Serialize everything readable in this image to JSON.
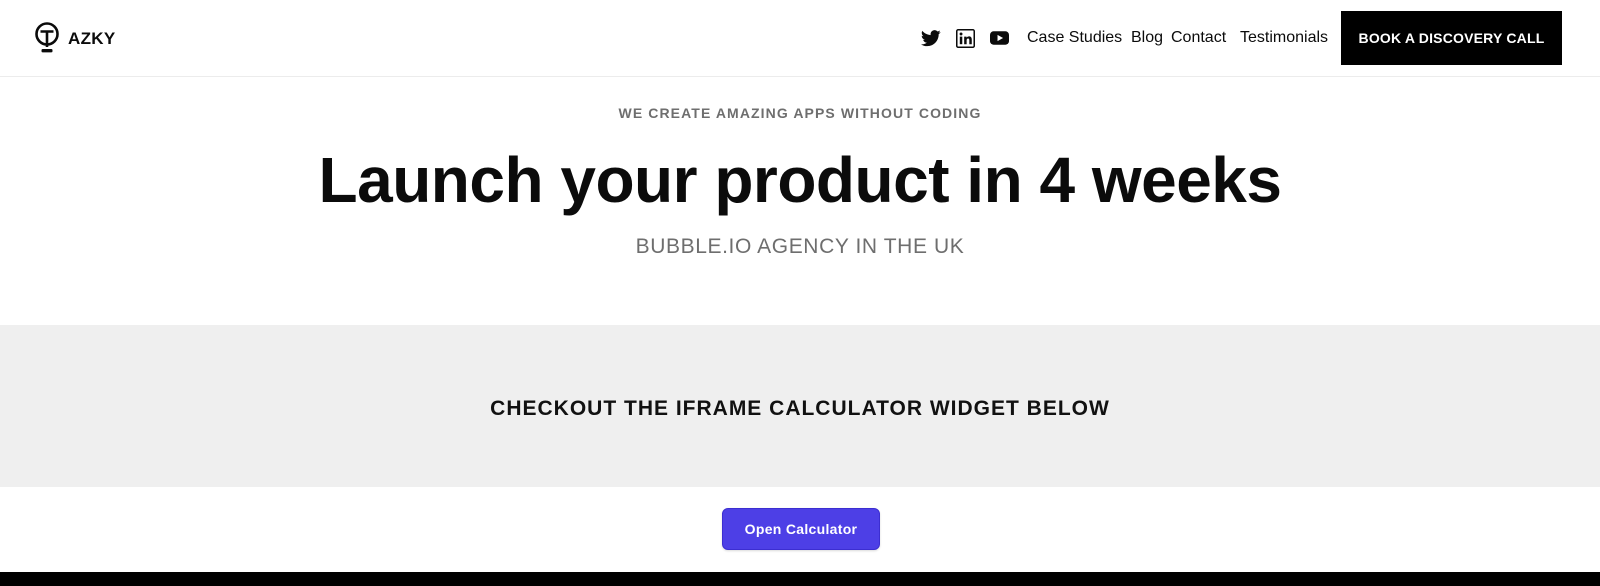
{
  "header": {
    "brand_name": "AZKY",
    "social": [
      "twitter-icon",
      "linkedin-icon",
      "youtube-icon"
    ],
    "nav_links": [
      "Case Studies",
      "Blog",
      "Contact",
      "Testimonials"
    ],
    "cta_label": "BOOK A DISCOVERY CALL"
  },
  "hero": {
    "eyebrow": "WE CREATE AMAZING APPS WITHOUT CODING",
    "headline": "Launch your product in 4 weeks",
    "subhead": "BUBBLE.IO AGENCY IN THE UK"
  },
  "calculator_section": {
    "title": "CHECKOUT THE IFRAME CALCULATOR WIDGET BELOW",
    "button_label": "Open Calculator"
  },
  "colors": {
    "accent": "#4d3fe6",
    "cta_background": "#000000",
    "band_background": "#efefef",
    "muted_text": "#6e6e6e"
  }
}
